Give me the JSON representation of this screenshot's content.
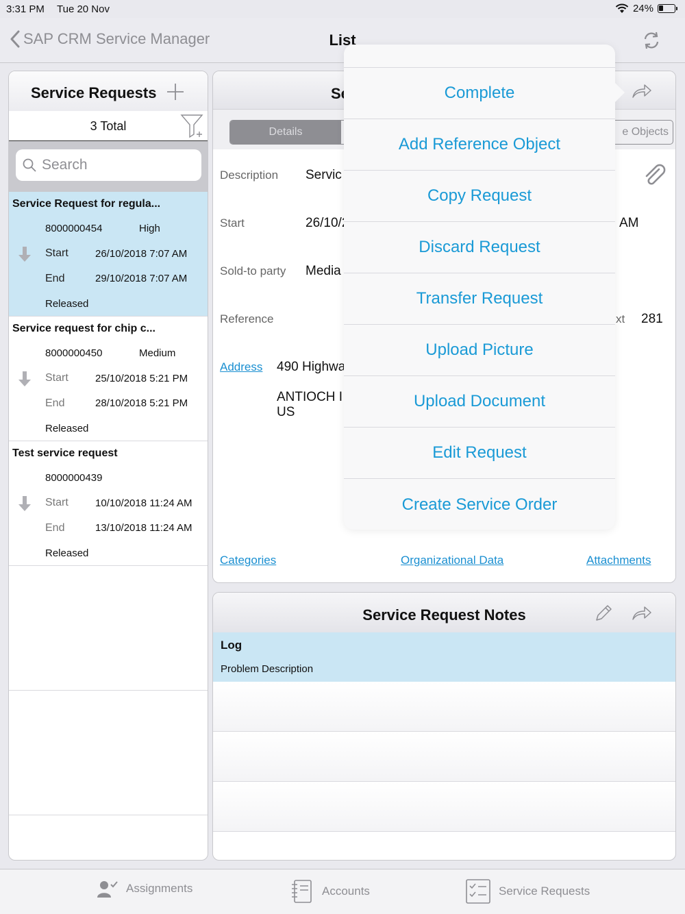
{
  "status": {
    "time": "3:31 PM",
    "date": "Tue 20 Nov",
    "battery": "24%"
  },
  "nav": {
    "back_label": "SAP CRM Service Manager",
    "title": "List"
  },
  "left": {
    "title": "Service Requests",
    "total": "3 Total",
    "search_placeholder": "Search",
    "requests": [
      {
        "title": "Service Request for regula...",
        "id": "8000000454",
        "priority": "High",
        "start_label": "Start",
        "start": "26/10/2018 7:07 AM",
        "end_label": "End",
        "end": "29/10/2018 7:07 AM",
        "status": "Released"
      },
      {
        "title": "Service request for chip c...",
        "id": "8000000450",
        "priority": "Medium",
        "start_label": "Start",
        "start": "25/10/2018 5:21 PM",
        "end_label": "End",
        "end": "28/10/2018 5:21 PM",
        "status": "Released"
      },
      {
        "title": "Test service request",
        "id": "8000000439",
        "priority": "",
        "start_label": "Start",
        "start": "10/10/2018 11:24 AM",
        "end_label": "End",
        "end": "13/10/2018 11:24 AM",
        "status": "Released"
      }
    ]
  },
  "detail": {
    "title": "Se",
    "segments": [
      "Details",
      "",
      "",
      "e Objects"
    ],
    "fields": {
      "description_label": "Description",
      "description_value": "Servic",
      "start_label": "Start",
      "start_value": "26/10/2",
      "start_suffix": "AM",
      "sold_to_label": "Sold-to party",
      "sold_to_value": "Media",
      "reference_label": "Reference",
      "ext_label": "xt",
      "ext_value": "281",
      "address_label": "Address",
      "address_line1": "490 Highwa",
      "address_line2": "ANTIOCH I",
      "address_line3": "US"
    },
    "links": {
      "categories": "Categories",
      "org_data": "Organizational Data",
      "attachments": "Attachments"
    }
  },
  "notes": {
    "title": "Service Request Notes",
    "log_title": "Log",
    "log_desc": "Problem Description"
  },
  "popover": {
    "items": [
      "Complete",
      "Add Reference Object",
      "Copy Request",
      "Discard Request",
      "Transfer Request",
      "Upload Picture",
      "Upload Document",
      "Edit Request",
      "Create Service Order"
    ]
  },
  "tabs": {
    "assignments": "Assignments",
    "accounts": "Accounts",
    "service_requests": "Service Requests"
  },
  "colors": {
    "accent": "#1a9ad6",
    "selected_row": "#cae6f4",
    "link": "#1a8fd1"
  }
}
